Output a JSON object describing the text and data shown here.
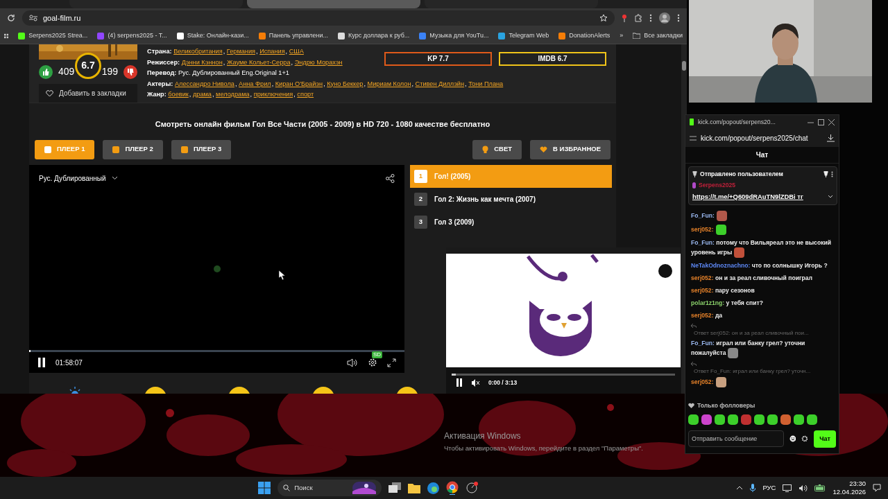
{
  "browser": {
    "tabs": [
      {
        "selected": false
      },
      {
        "selected": true
      },
      {
        "selected": false
      }
    ],
    "url": "goal-film.ru",
    "bookmarks": [
      {
        "label": "Serpens2025 Strea...",
        "color": "#53fc18"
      },
      {
        "label": "(4) serpens2025 - T...",
        "color": "#9146ff"
      },
      {
        "label": "Stake: Онлайн-кази...",
        "color": "#ffffff"
      },
      {
        "label": "Панель управлени...",
        "color": "#f57d07"
      },
      {
        "label": "Курс доллара к руб...",
        "color": "#dddddd"
      },
      {
        "label": "Музыка для YouTu...",
        "color": "#3b82f6"
      },
      {
        "label": "Telegram Web",
        "color": "#2aa3e0"
      },
      {
        "label": "DonationAlerts",
        "color": "#f57d07"
      }
    ],
    "more": "»",
    "all_bookmarks": "Все закладки"
  },
  "movie": {
    "rating": "6.7",
    "likes": "409",
    "dislikes": "199",
    "bookmark_label": "Добавить в закладки",
    "details": [
      {
        "label": "Страна:",
        "kind": "links",
        "separator": ",",
        "items": [
          "Великобритания",
          "Германия",
          "Испания",
          "США"
        ]
      },
      {
        "label": "Режиссер:",
        "kind": "links",
        "separator": ",",
        "items": [
          "Дэнни Кэннон",
          "Жауме Кольет-Серра",
          "Эндрю Морахэн"
        ]
      },
      {
        "label": "Перевод:",
        "kind": "text",
        "items": [
          "Рус. Дублированный Eng.Original 1+1"
        ]
      },
      {
        "label": "Актеры:",
        "kind": "links",
        "separator": ",",
        "items": [
          "Алессандро Нивола",
          "Анна Фрил",
          "Киран О'Брайэн",
          "Куно Беккер",
          "Мириам Колон",
          "Стивен Диллэйн",
          "Тони Плана"
        ]
      },
      {
        "label": "Жанр:",
        "kind": "links",
        "separator": ",",
        "items": [
          "боевик",
          "драма",
          "мелодрама",
          "приключения",
          "спорт"
        ]
      }
    ],
    "kp": "KP 7.7",
    "imdb": "IMDB 6.7",
    "heading": "Смотреть онлайн фильм Гол Все Части (2005 - 2009) в HD 720 - 1080 качестве бесплатно",
    "players": [
      {
        "label": "ПЛЕЕР 1",
        "selected": true
      },
      {
        "label": "ПЛЕЕР 2",
        "selected": false
      },
      {
        "label": "ПЛЕЕР 3",
        "selected": false
      }
    ],
    "light": "СВЕТ",
    "favorite": "В ИЗБРАННОЕ"
  },
  "video": {
    "audio_track": "Рус. Дублированный",
    "time": "01:58:07",
    "level": 0.004,
    "quality": "SD"
  },
  "episodes": [
    {
      "number": "1",
      "title": "Гол! (2005)",
      "selected": true
    },
    {
      "number": "2",
      "title": "Гол 2: Жизнь как мечта (2007)",
      "selected": false
    },
    {
      "number": "3",
      "title": "Гол 3 (2009)",
      "selected": false
    }
  ],
  "pip": {
    "time": "0:00 / 3:13",
    "level": 0.02
  },
  "chat": {
    "window_title": "kick.com/popout/serpens20...",
    "address": "kick.com/popout/serpens2025/chat",
    "title": "Чат",
    "pinned": {
      "header": "Отправлено пользователем",
      "user": "Serpens2025",
      "text": "https://t.me/+Q609dRAuTN9lZDBi тг"
    },
    "messages": [
      {
        "kind": "emote",
        "user": "Fo_Fun:",
        "color": "#9ab8f0"
      },
      {
        "kind": "emote",
        "user": "serj052:",
        "color": "#e8832a"
      },
      {
        "kind": "text_emote",
        "user": "Fo_Fun:",
        "color": "#9ab8f0",
        "text": "потому что Вильяреал это не высокий уровень игры"
      },
      {
        "kind": "text",
        "user": "NeTakOdnoznachno:",
        "color": "#5d88f5",
        "text": "что по солнышку Игорь ?"
      },
      {
        "kind": "text",
        "user": "serj052:",
        "color": "#e8832a",
        "text": "он и за реал сливочный поиграл"
      },
      {
        "kind": "text",
        "user": "serj052:",
        "color": "#e8832a",
        "text": "пару сезонов"
      },
      {
        "kind": "text",
        "user": "polar1z1ng:",
        "color": "#8ad06a",
        "text": "у тебя спит?"
      },
      {
        "kind": "text",
        "user": "serj052:",
        "color": "#e8832a",
        "text": "да"
      },
      {
        "kind": "text_emote",
        "reply": "Ответ serj052: он и за реал сливочный пои...",
        "user": "Fo_Fun:",
        "color": "#9ab8f0",
        "text": "играл или банку грел? уточни пожалуйста"
      },
      {
        "kind": "emote",
        "reply": "Ответ Fo_Fun: играл или банку грел? уточн...",
        "user": "serj052:",
        "color": "#e8832a"
      }
    ],
    "followers_only": "Только фолловеры",
    "emotes": [
      {
        "color": "#3ccf2a"
      },
      {
        "color": "#cc44cc"
      },
      {
        "color": "#3ccf2a"
      },
      {
        "color": "#3ccf2a"
      },
      {
        "color": "#c03030"
      },
      {
        "color": "#3ccf2a"
      },
      {
        "color": "#3ccf2a"
      },
      {
        "color": "#d06030"
      },
      {
        "color": "#3ccf2a"
      },
      {
        "color": "#3ccf2a"
      }
    ],
    "placeholder": "Отправить сообщение",
    "send": "Чат"
  },
  "activation": {
    "title": "Активация Windows",
    "text": "Чтобы активировать Windows, перейдите в раздел \"Параметры\"."
  },
  "taskbar": {
    "search": "Поиск",
    "language": "РУС",
    "time": "23:30",
    "date": "12.04.2026"
  }
}
